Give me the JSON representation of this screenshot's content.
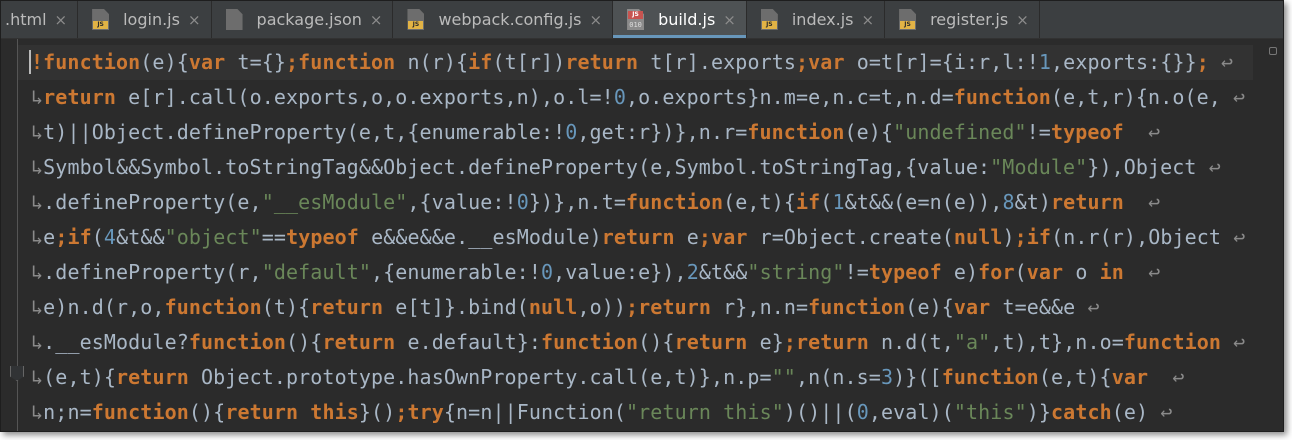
{
  "tabs": [
    {
      "label": ".html",
      "icon": "html-file-icon",
      "active": false
    },
    {
      "label": "login.js",
      "icon": "js-file-icon",
      "active": false
    },
    {
      "label": "package.json",
      "icon": "json-file-icon",
      "active": false
    },
    {
      "label": "webpack.config.js",
      "icon": "js-file-icon",
      "active": false
    },
    {
      "label": "build.js",
      "icon": "binary-js-file-icon",
      "active": true
    },
    {
      "label": "index.js",
      "icon": "js-file-icon",
      "active": false
    },
    {
      "label": "register.js",
      "icon": "js-file-icon",
      "active": false
    }
  ],
  "tab_close_glyph": "×",
  "icon_badge_text": "JS",
  "binary_icon_bits": "010",
  "colors": {
    "keyword": "#cc7832",
    "text": "#a9b7c6",
    "string": "#6a8759",
    "number": "#6897bb",
    "background": "#2b2b2b",
    "tab_bar": "#3c3f41",
    "wrap_marker": "#8a8a8a"
  },
  "wrap_end_glyph": "↩",
  "wrap_start_glyph": "↳",
  "code_lines": [
    [
      [
        "k",
        "!function"
      ],
      [
        "t",
        "(e){"
      ],
      [
        "k",
        "var "
      ],
      [
        "t",
        "t={}"
      ],
      [
        "k",
        ";function "
      ],
      [
        "t",
        "n(r){"
      ],
      [
        "k",
        "if"
      ],
      [
        "t",
        "(t[r])"
      ],
      [
        "k",
        "return "
      ],
      [
        "t",
        "t[r].exports"
      ],
      [
        "k",
        ";var "
      ],
      [
        "t",
        "o=t[r]={i:r,l:"
      ],
      [
        "t",
        "!"
      ],
      [
        "n",
        "1"
      ],
      [
        "t",
        ",exports:{}}"
      ],
      [
        "k",
        ";"
      ]
    ],
    [
      [
        "k",
        "return "
      ],
      [
        "t",
        "e[r].call(o.exports,o,o.exports,n),o.l="
      ],
      [
        "t",
        "!"
      ],
      [
        "n",
        "0"
      ],
      [
        "t",
        ",o.exports}n.m=e,n.c=t,n.d="
      ],
      [
        "k",
        "function"
      ],
      [
        "t",
        "(e,t,r){n.o(e,"
      ]
    ],
    [
      [
        "t",
        "t)||Object.defineProperty(e,t,{enumerable:!"
      ],
      [
        "n",
        "0"
      ],
      [
        "t",
        ",get:r})},n.r="
      ],
      [
        "k",
        "function"
      ],
      [
        "t",
        "(e){"
      ],
      [
        "s",
        "\"undefined\""
      ],
      [
        "t",
        "!="
      ],
      [
        "k",
        "typeof "
      ]
    ],
    [
      [
        "t",
        "Symbol&&Symbol.toStringTag&&Object.defineProperty(e,Symbol.toStringTag,{value:"
      ],
      [
        "s",
        "\"Module\""
      ],
      [
        "t",
        "}),Object"
      ]
    ],
    [
      [
        "t",
        ".defineProperty(e,"
      ],
      [
        "s",
        "\"__esModule\""
      ],
      [
        "t",
        ",{value:!"
      ],
      [
        "n",
        "0"
      ],
      [
        "t",
        "})},n.t="
      ],
      [
        "k",
        "function"
      ],
      [
        "t",
        "(e,t){"
      ],
      [
        "k",
        "if"
      ],
      [
        "t",
        "("
      ],
      [
        "n",
        "1"
      ],
      [
        "t",
        "&t&&(e=n(e)),"
      ],
      [
        "n",
        "8"
      ],
      [
        "t",
        "&t)"
      ],
      [
        "k",
        "return "
      ]
    ],
    [
      [
        "t",
        "e"
      ],
      [
        "k",
        ";if"
      ],
      [
        "t",
        "("
      ],
      [
        "n",
        "4"
      ],
      [
        "t",
        "&t&&"
      ],
      [
        "s",
        "\"object\""
      ],
      [
        "t",
        "=="
      ],
      [
        "k",
        "typeof "
      ],
      [
        "t",
        "e&&e&&e.__esModule)"
      ],
      [
        "k",
        "return "
      ],
      [
        "t",
        "e"
      ],
      [
        "k",
        ";var "
      ],
      [
        "t",
        "r=Object.create("
      ],
      [
        "k",
        "null"
      ],
      [
        "t",
        ")"
      ],
      [
        "k",
        ";if"
      ],
      [
        "t",
        "(n.r(r),Object"
      ]
    ],
    [
      [
        "t",
        ".defineProperty(r,"
      ],
      [
        "s",
        "\"default\""
      ],
      [
        "t",
        ",{enumerable:!"
      ],
      [
        "n",
        "0"
      ],
      [
        "t",
        ",value:e}),"
      ],
      [
        "n",
        "2"
      ],
      [
        "t",
        "&t&&"
      ],
      [
        "s",
        "\"string\""
      ],
      [
        "t",
        "!="
      ],
      [
        "k",
        "typeof "
      ],
      [
        "t",
        "e)"
      ],
      [
        "k",
        "for"
      ],
      [
        "t",
        "("
      ],
      [
        "k",
        "var "
      ],
      [
        "t",
        "o "
      ],
      [
        "k",
        "in "
      ]
    ],
    [
      [
        "t",
        "e)n.d(r,o,"
      ],
      [
        "k",
        "function"
      ],
      [
        "t",
        "(t){"
      ],
      [
        "k",
        "return "
      ],
      [
        "t",
        "e[t]}.bind("
      ],
      [
        "k",
        "null"
      ],
      [
        "t",
        ",o))"
      ],
      [
        "k",
        ";return "
      ],
      [
        "t",
        "r},n.n="
      ],
      [
        "k",
        "function"
      ],
      [
        "t",
        "(e){"
      ],
      [
        "k",
        "var "
      ],
      [
        "t",
        "t=e&&e"
      ]
    ],
    [
      [
        "t",
        ".__esModule?"
      ],
      [
        "k",
        "function"
      ],
      [
        "t",
        "(){"
      ],
      [
        "k",
        "return "
      ],
      [
        "t",
        "e.default}:"
      ],
      [
        "k",
        "function"
      ],
      [
        "t",
        "(){"
      ],
      [
        "k",
        "return "
      ],
      [
        "t",
        "e}"
      ],
      [
        "k",
        ";return "
      ],
      [
        "t",
        "n.d(t,"
      ],
      [
        "s",
        "\"a\""
      ],
      [
        "t",
        ",t),t},n.o="
      ],
      [
        "k",
        "function"
      ]
    ],
    [
      [
        "t",
        "(e,t){"
      ],
      [
        "k",
        "return "
      ],
      [
        "t",
        "Object.prototype.hasOwnProperty.call(e,t)},n.p="
      ],
      [
        "s",
        "\"\""
      ],
      [
        "t",
        ",n(n.s="
      ],
      [
        "n",
        "3"
      ],
      [
        "t",
        ")}(["
      ],
      [
        "k",
        "function"
      ],
      [
        "t",
        "(e,t){"
      ],
      [
        "k",
        "var "
      ]
    ],
    [
      [
        "t",
        "n;n="
      ],
      [
        "k",
        "function"
      ],
      [
        "t",
        "(){"
      ],
      [
        "k",
        "return this"
      ],
      [
        "t",
        "}()"
      ],
      [
        "k",
        ";try"
      ],
      [
        "t",
        "{n=n||Function("
      ],
      [
        "s",
        "\"return this\""
      ],
      [
        "t",
        ")()||("
      ],
      [
        "n",
        "0"
      ],
      [
        "t",
        ",eval)("
      ],
      [
        "s",
        "\"this\""
      ],
      [
        "t",
        ")}"
      ],
      [
        "k",
        "catch"
      ],
      [
        "t",
        "(e)"
      ]
    ]
  ]
}
